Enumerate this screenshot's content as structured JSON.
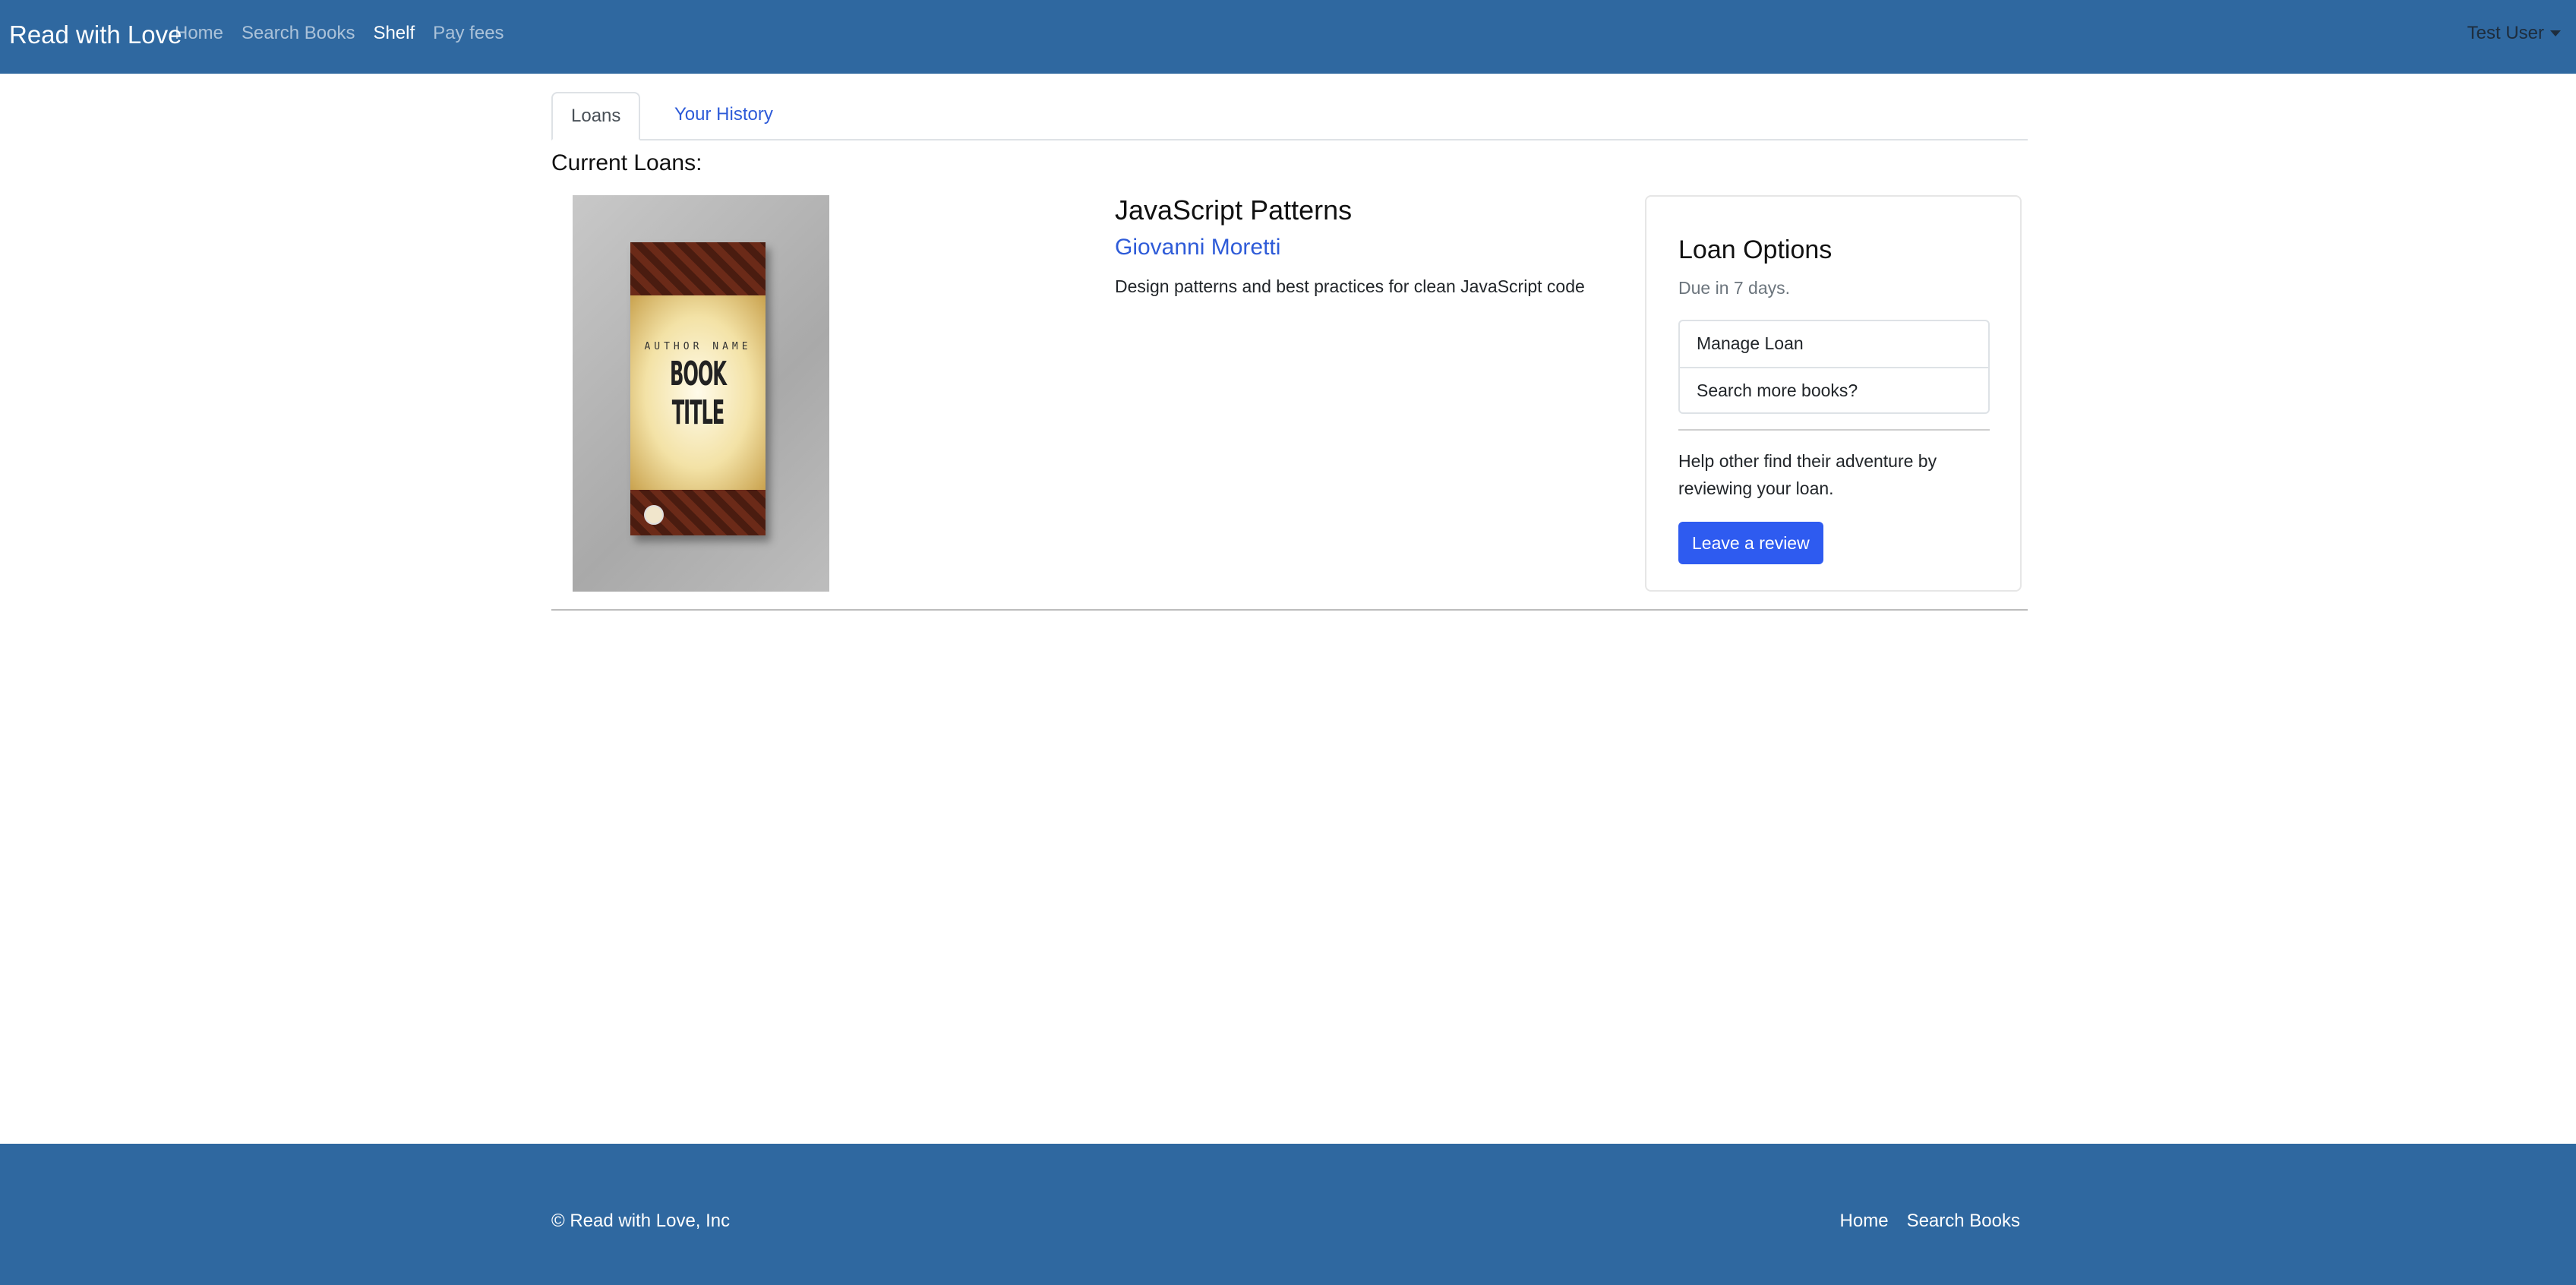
{
  "navbar": {
    "brand": "Read with Love",
    "links": [
      {
        "label": "Home"
      },
      {
        "label": "Search Books"
      },
      {
        "label": "Shelf"
      },
      {
        "label": "Pay fees"
      }
    ],
    "user": "Test User",
    "active": "Shelf",
    "background": "#2f68a0"
  },
  "tabs": [
    {
      "label": "Loans"
    },
    {
      "label": "Your History"
    }
  ],
  "section_title": "Current Loans:",
  "loan": {
    "cover": {
      "author_text": "AUTHOR NAME",
      "title_text": "BOOK TITLE"
    },
    "title": "JavaScript Patterns",
    "author": "Giovanni Moretti",
    "description": "Design patterns and best practices for clean JavaScript code"
  },
  "loan_options": {
    "title": "Loan Options",
    "due": "Due in 7 days.",
    "items": [
      {
        "label": "Manage Loan"
      },
      {
        "label": "Search more books?"
      }
    ],
    "help_text": "Help other find their adventure by reviewing your loan.",
    "review_button": "Leave a review",
    "button_color": "#2e5bf0"
  },
  "footer": {
    "copyright": "© Read with Love, Inc",
    "links": [
      {
        "label": "Home"
      },
      {
        "label": "Search Books"
      }
    ]
  }
}
